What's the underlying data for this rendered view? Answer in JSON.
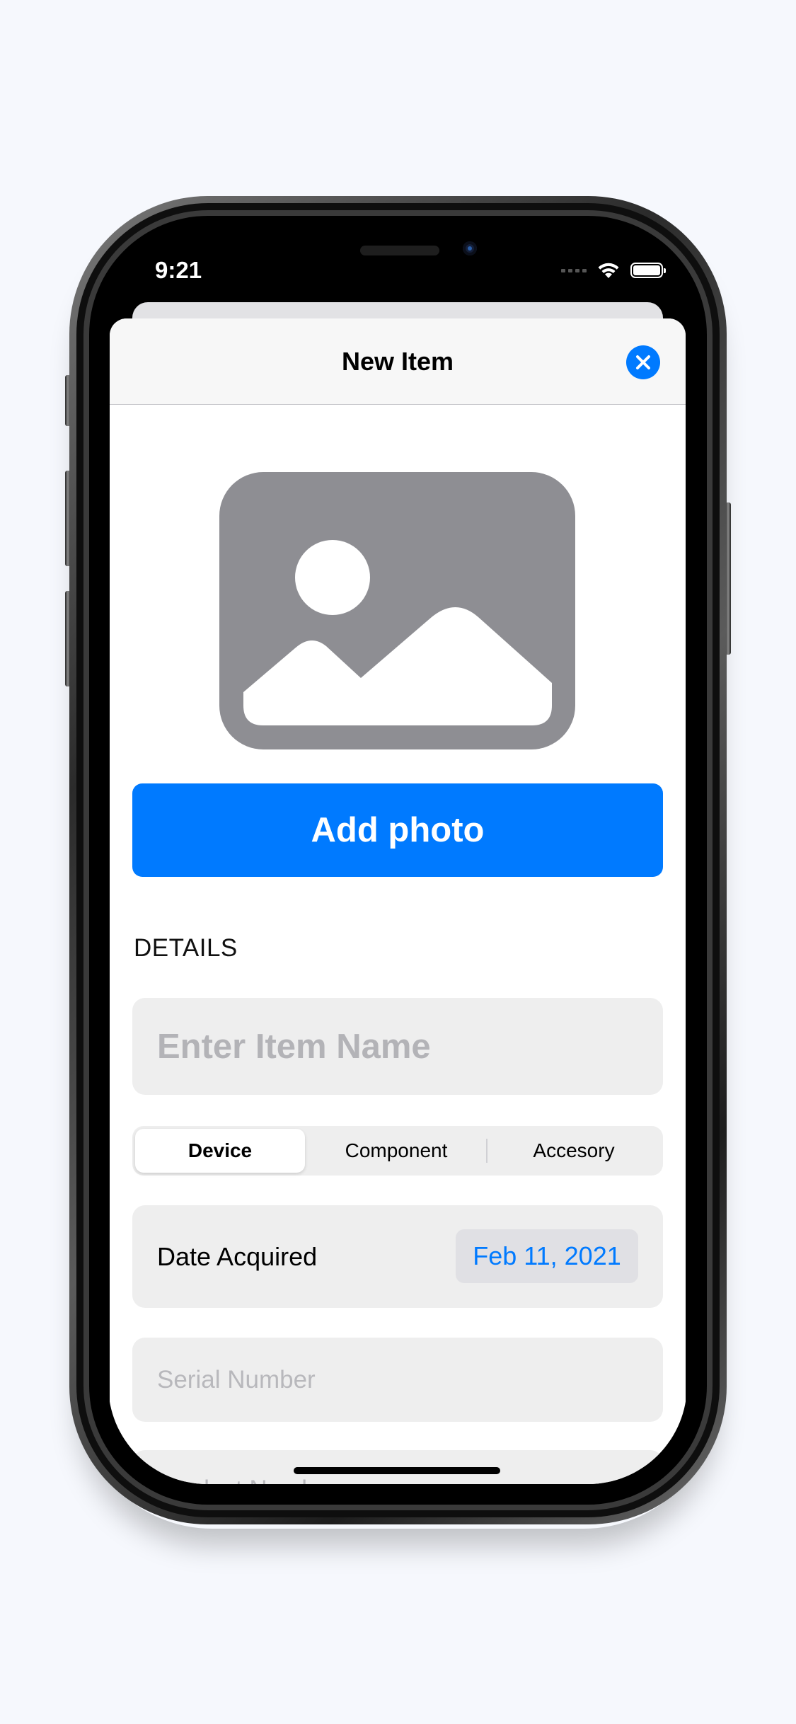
{
  "status_bar": {
    "time": "9:21",
    "wifi_icon": "wifi-icon",
    "battery_icon": "battery-icon"
  },
  "nav": {
    "title": "New Item",
    "close_icon": "close-icon"
  },
  "photo": {
    "placeholder_icon": "photo-placeholder-icon",
    "add_label": "Add photo"
  },
  "details": {
    "header": "DETAILS",
    "name_placeholder": "Enter Item Name",
    "name_value": "",
    "type_segments": [
      "Device",
      "Component",
      "Accesory"
    ],
    "selected_segment": "Device",
    "date_label": "Date Acquired",
    "date_value": "Feb 11, 2021",
    "serial_placeholder": "Serial Number",
    "next_field_placeholder": "Product Number"
  },
  "colors": {
    "accent": "#007aff",
    "field_bg": "#eeeeee",
    "placeholder": "#b3b3b7",
    "icon_gray": "#8e8e93",
    "background": "#f6f8fd"
  }
}
